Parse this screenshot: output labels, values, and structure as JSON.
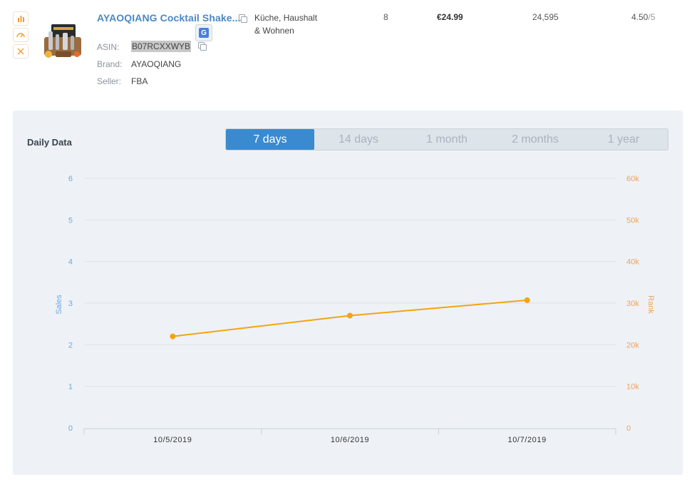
{
  "product": {
    "title": "AYAOQIANG Cocktail Shake...",
    "asin_label": "ASIN:",
    "asin": "B07RCXXWYB",
    "brand_label": "Brand:",
    "brand": "AYAOQIANG",
    "seller_label": "Seller:",
    "seller": "FBA",
    "category": "Küche, Haushalt & Wohnen",
    "quantity": "8",
    "price": "€24.99",
    "rank": "24,595",
    "rating": "4.50",
    "rating_max": "/5",
    "side_icons": [
      "bar-chart-icon",
      "gauge-icon",
      "close-icon"
    ]
  },
  "panel": {
    "title": "Daily Data",
    "tabs": [
      "7 days",
      "14 days",
      "1 month",
      "2 months",
      "1 year"
    ],
    "active_tab": 0
  },
  "colors": {
    "accent": "#3a8ad0",
    "line": "#f5a310",
    "left_axis": "#6fa6db",
    "right_axis": "#f0a15a"
  },
  "chart_data": {
    "type": "line",
    "x": [
      "10/5/2019",
      "10/6/2019",
      "10/7/2019"
    ],
    "series": [
      {
        "values": [
          22000,
          27000,
          30700
        ],
        "axis": "right"
      }
    ],
    "y_left": {
      "label": "Sales",
      "ticks": [
        "0",
        "1",
        "2",
        "3",
        "4",
        "5",
        "6"
      ],
      "range": [
        0,
        6
      ]
    },
    "y_right": {
      "label": "Rank",
      "ticks": [
        "0",
        "10k",
        "20k",
        "30k",
        "40k",
        "50k",
        "60k"
      ],
      "range": [
        0,
        60000
      ]
    },
    "grid": true,
    "legend": "none"
  }
}
